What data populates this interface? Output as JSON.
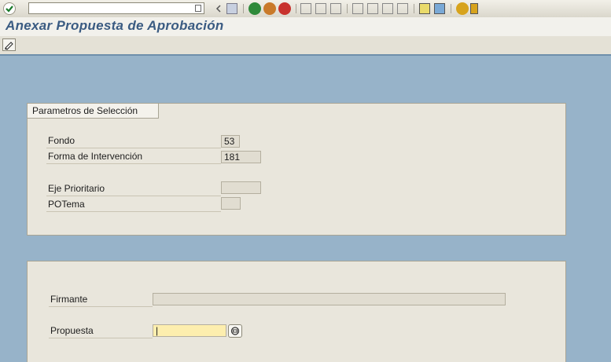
{
  "toolbar": {
    "enter_icon": "checkmark-icon",
    "command_field_value": "",
    "colors": {
      "back": "#2f8a3a",
      "exit": "#c97a2a",
      "cancel": "#c8322d",
      "help": "#d7a31c"
    }
  },
  "window": {
    "title": "Anexar Propuesta de Aprobación"
  },
  "app_toolbar": {
    "edit_icon": "pencil-icon"
  },
  "selection": {
    "group_title": "Parametros de Selección",
    "fondo_label": "Fondo",
    "fondo_value": "53",
    "forma_label": "Forma de Intervención",
    "forma_value": "181",
    "eje_label": "Eje Prioritario",
    "eje_value": "",
    "potema_label": "POTema",
    "potema_value": ""
  },
  "form": {
    "firmante_label": "Firmante",
    "firmante_value": "",
    "propuesta_label": "Propuesta",
    "propuesta_value": "|",
    "search_help_icon": "search-help-icon"
  }
}
